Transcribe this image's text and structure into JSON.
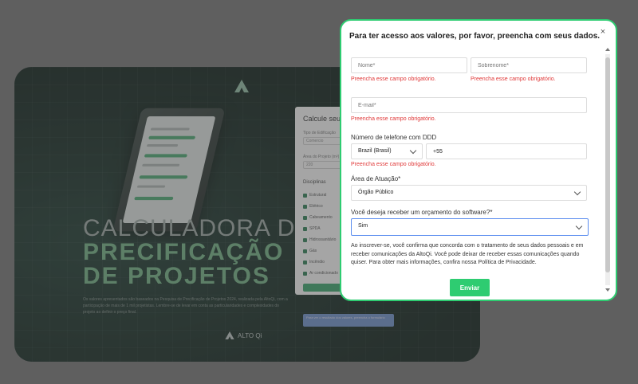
{
  "background": {
    "title_line1": "CALCULADORA DE",
    "title_line2": "PRECIFICAÇÃO",
    "title_line3": "DE PROJETOS",
    "description": "Os valores apresentados são baseados na Pesquisa de Precificação de Projetos 2024, realizada pela AltoQi, com a participação de mais de 1 mil projetistas. Lembre-se de levar em conta as particularidades e complexidades do projeto ao definir o preço final.",
    "brand": "ALTO Qi",
    "calc_title": "Calcule seu",
    "calc_label1": "Tipo de Edificação",
    "calc_value1": "Comercio",
    "calc_label2": "Área do Projeto (m²)",
    "calc_value2": "220",
    "disciplines_title": "Disciplinas",
    "disciplines": [
      "Estrutural",
      "Elétrico",
      "Cabeamento",
      "SPDA",
      "Hidrossanitário",
      "Gás",
      "Incêndio",
      "Ar condicionado"
    ],
    "tip_text": "Para ver o resultado dos valores, preencha o formulário"
  },
  "modal": {
    "heading": "Para ter acesso aos valores, por favor, preencha com seus dados.",
    "close_label": "×",
    "first_name_placeholder": "Nome*",
    "last_name_placeholder": "Sobrenome*",
    "email_placeholder": "E-mail*",
    "required_error": "Preencha esse campo obrigatório.",
    "phone_label": "Número de telefone com DDD",
    "country_value": "Brazil (Brasil)",
    "phone_value": "+55",
    "area_label": "Área de Atuação*",
    "area_value": "Órgão Público",
    "budget_label": "Você deseja receber um orçamento do software?*",
    "budget_value": "Sim",
    "consent_note": "Ao inscrever-se, você confirma que concorda com o tratamento de seus dados pessoais e em receber comunicações da AltoQi. Você pode deixar de receber essas comunicações quando quiser. Para obter mais informações, confira nossa Política de Privacidade.",
    "submit_label": "Enviar"
  },
  "colors": {
    "accent": "#2ecc71",
    "error": "#e03a3a",
    "focus": "#5b8def"
  }
}
